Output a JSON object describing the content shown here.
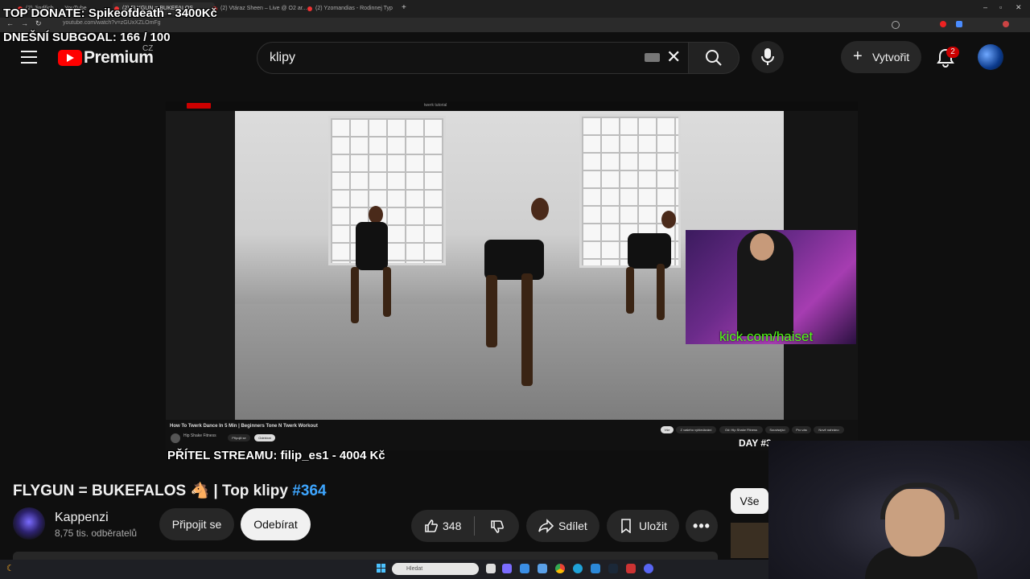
{
  "browser": {
    "tabs": [
      {
        "label": "(2) Jindřich... – YouTube"
      },
      {
        "label": "(2) FLYGUN = BUKEFALOS"
      },
      {
        "label": "(2) Vtáraz Sheen – Live @ O2 ar..."
      },
      {
        "label": "(2) Yzomandias - Rodinnej Typ"
      }
    ],
    "new_tab_glyph": "+",
    "url": "youtube.com/watch?v=zGUxXZLOmFg"
  },
  "stream_overlay": {
    "top_donate": "TOP DONATE: Spikeofdeath - 3400Kč",
    "subgoal": "DNEŠNÍ SUBGOAL: 166 / 100",
    "friend": "PŘÍTEL STREAMU: filip_es1 - 4004 Kč",
    "kick": "kick.com/haiset"
  },
  "header": {
    "brand": "Premium",
    "region": "CZ",
    "search_query": "klipy",
    "create_label": "Vytvořit",
    "notification_count": "2"
  },
  "player": {
    "embedded_title": "How To Twerk Dance In 5 Min | Beginners Tone N Twerk Workout",
    "embedded_channel": "Hip Shake Fitness",
    "embedded_search": "twerk tutorial",
    "embedded_join": "Připojit se",
    "embedded_subscribe": "Odebírat",
    "embedded_chips": [
      "Vše",
      "Z vašeho vyhledávání",
      "Od: Hip Shake Fitness",
      "Související",
      "Pro vás",
      "Nově nahráno"
    ],
    "day_text": "DAY #3"
  },
  "video": {
    "title_text": "FLYGUN = BUKEFALOS 🐴 | Top klipy ",
    "hashtag": "#364",
    "channel_name": "Kappenzi",
    "subscribers": "8,75 tis. odběratelů",
    "join_label": "Připojit se",
    "subscribe_label": "Odebírat",
    "like_count": "348",
    "share_label": "Sdílet",
    "save_label": "Uložit",
    "chip_all": "Vše"
  },
  "taskbar": {
    "search_placeholder": "Hledat"
  },
  "colors": {
    "brand_red": "#ff0000",
    "link_blue": "#3ea6ff",
    "kick_green": "#53fc18",
    "badge_red": "#cc0000"
  },
  "icons": [
    "menu-icon",
    "youtube-logo-icon",
    "keyboard-icon",
    "close-icon",
    "search-icon",
    "mic-icon",
    "plus-icon",
    "bell-icon",
    "like-icon",
    "dislike-icon",
    "share-icon",
    "save-icon",
    "more-icon",
    "windows-start-icon"
  ]
}
